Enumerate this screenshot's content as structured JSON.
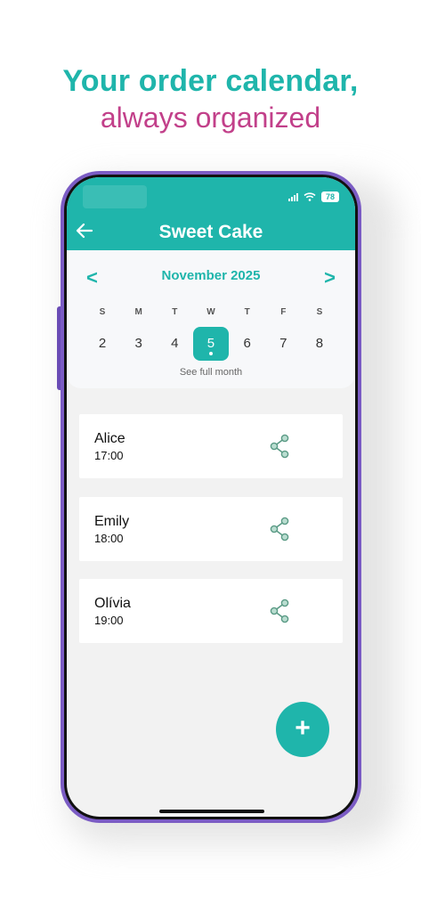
{
  "promo": {
    "line1": "Your order calendar,",
    "line2": "always organized"
  },
  "status_bar": {
    "battery": "78"
  },
  "header": {
    "title": "Sweet Cake",
    "back_icon": "arrow-left-icon"
  },
  "calendar": {
    "month": "November 2025",
    "prev": "<",
    "next": ">",
    "weekdays": [
      "S",
      "M",
      "T",
      "W",
      "T",
      "F",
      "S"
    ],
    "days": [
      "2",
      "3",
      "4",
      "5",
      "6",
      "7",
      "8"
    ],
    "selected_day": "5",
    "see_full_month": "See full month"
  },
  "orders": [
    {
      "name": "Alice",
      "time": "17:00"
    },
    {
      "name": "Emily",
      "time": "18:00"
    },
    {
      "name": "Olívia",
      "time": "19:00"
    }
  ],
  "fab": {
    "label": "+"
  },
  "colors": {
    "primary": "#1fb5ab",
    "accent": "#c2408a",
    "phone_frame": "#7b5cc4",
    "share_icon": "#5a9a85"
  }
}
